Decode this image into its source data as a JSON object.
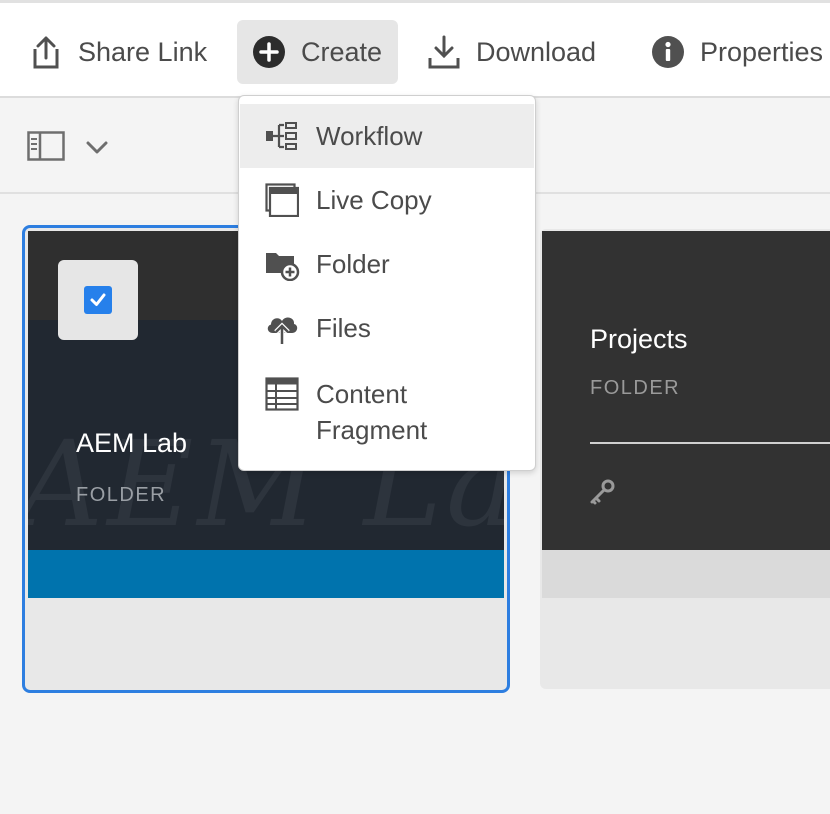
{
  "actionbar": {
    "share_label": "Share Link",
    "create_label": "Create",
    "download_label": "Download",
    "properties_label": "Properties ("
  },
  "create_menu": {
    "items": [
      {
        "label": "Workflow",
        "icon": "workflow-icon"
      },
      {
        "label": "Live Copy",
        "icon": "live-copy-icon"
      },
      {
        "label": "Folder",
        "icon": "folder-add-icon"
      },
      {
        "label": "Files",
        "icon": "upload-cloud-icon"
      },
      {
        "label": "Content Fragment",
        "icon": "content-fragment-icon"
      }
    ]
  },
  "cards": [
    {
      "title": "AEM Lab",
      "type": "FOLDER",
      "watermark": "AEM Lab",
      "selected": true
    },
    {
      "title": "Projects",
      "type": "FOLDER",
      "selected": false
    }
  ],
  "colors": {
    "accent": "#2680eb",
    "selection_border": "#2d7ee0",
    "card_band": "#0073ad",
    "toolbar_bg": "#ffffff",
    "page_bg": "#f4f4f4"
  }
}
